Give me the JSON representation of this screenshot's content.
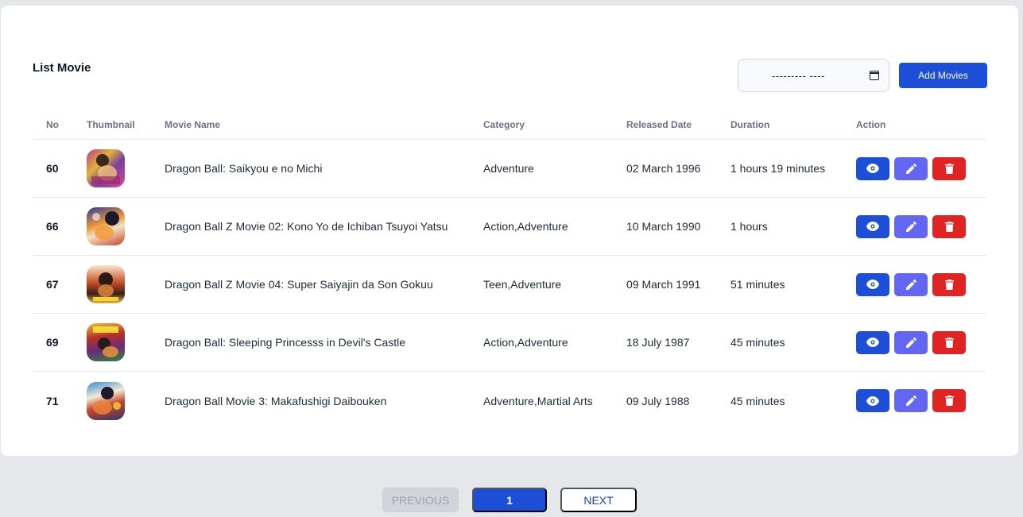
{
  "page": {
    "title": "List Movie"
  },
  "toolbar": {
    "date_value": "--------- ----",
    "add_label": "Add Movies"
  },
  "table": {
    "headers": [
      "No",
      "Thumbnail",
      "Movie Name",
      "Category",
      "Released Date",
      "Duration",
      "Action"
    ],
    "rows": [
      {
        "no": "60",
        "name": "Dragon Ball: Saikyou e no Michi",
        "category": "Adventure",
        "released": "02 March 1996",
        "duration": "1 hours 19 minutes"
      },
      {
        "no": "66",
        "name": "Dragon Ball Z Movie 02: Kono Yo de Ichiban Tsuyoi Yatsu",
        "category": "Action,Adventure",
        "released": "10 March 1990",
        "duration": "1 hours"
      },
      {
        "no": "67",
        "name": "Dragon Ball Z Movie 04: Super Saiyajin da Son Gokuu",
        "category": "Teen,Adventure",
        "released": "09 March 1991",
        "duration": "51 minutes"
      },
      {
        "no": "69",
        "name": "Dragon Ball: Sleeping Princesss in Devil's Castle",
        "category": "Action,Adventure",
        "released": "18 July 1987",
        "duration": "45 minutes"
      },
      {
        "no": "71",
        "name": "Dragon Ball Movie 3: Makafushigi Daibouken",
        "category": "Adventure,Martial Arts",
        "released": "09 July 1988",
        "duration": "45 minutes"
      }
    ]
  },
  "pagination": {
    "previous": "PREVIOUS",
    "current": "1",
    "next": "NEXT"
  },
  "icons": {
    "view": "eye-icon",
    "edit": "pencil-icon",
    "delete": "trash-icon",
    "calendar": "calendar-icon"
  },
  "colors": {
    "primary": "#1d4ed8",
    "edit": "#6366f1",
    "delete": "#e02424",
    "background": "#e5e7eb"
  }
}
